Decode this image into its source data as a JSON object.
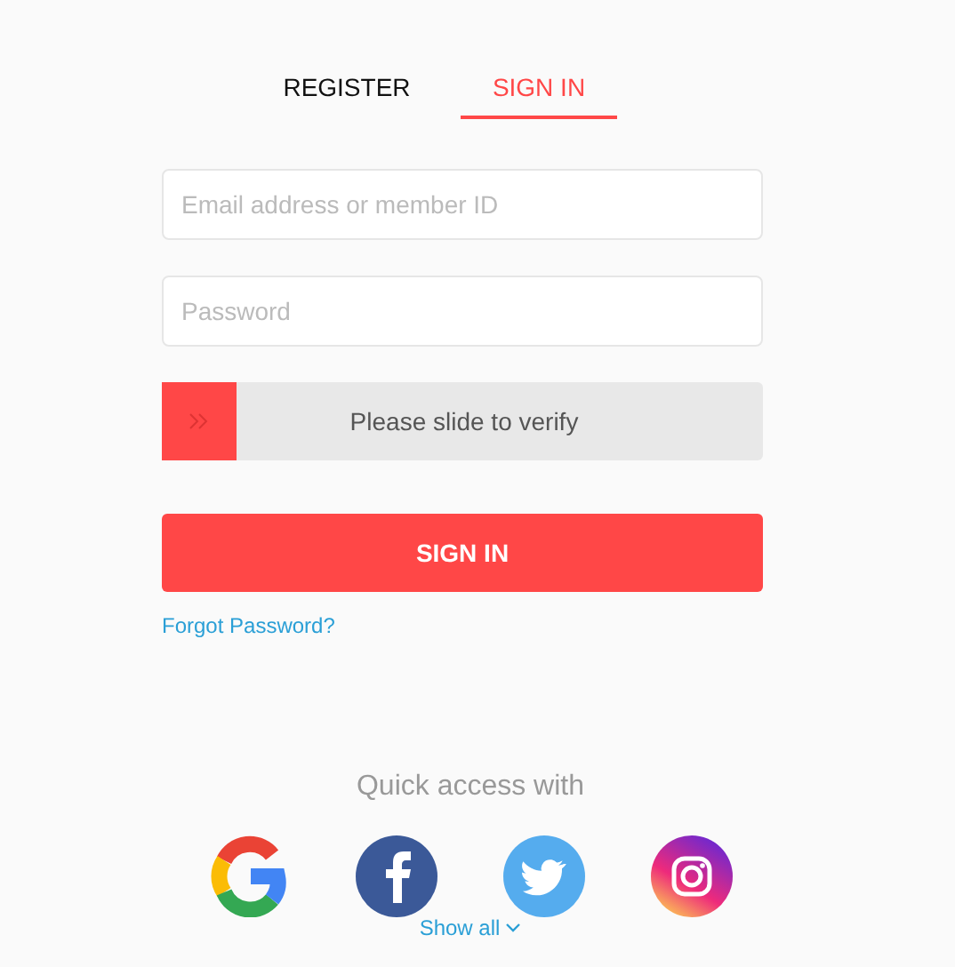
{
  "tabs": [
    {
      "label": "REGISTER",
      "selected": false
    },
    {
      "label": "SIGN IN",
      "selected": true
    }
  ],
  "email": {
    "placeholder": "Email address or member ID"
  },
  "password": {
    "placeholder": "Password"
  },
  "slider": {
    "label": "Please slide to verify",
    "level": 0
  },
  "submit": "SIGN IN",
  "forgot": "Forgot Password?",
  "quick_access": {
    "title": "Quick access with",
    "show_all": "Show all"
  }
}
